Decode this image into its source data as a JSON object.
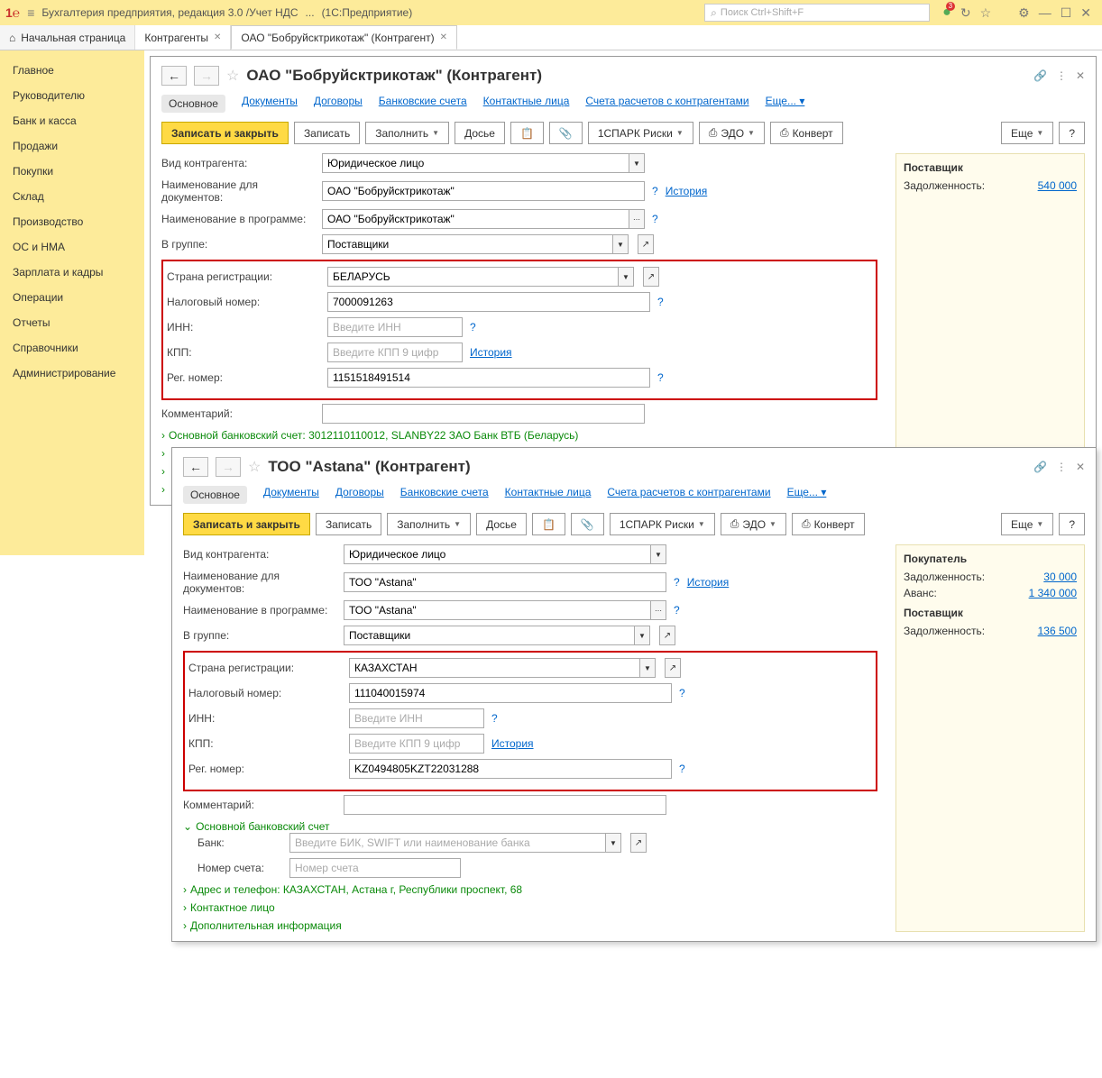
{
  "titlebar": {
    "app": "Бухгалтерия предприятия, редакция 3.0 /Учет НДС",
    "dots": "...",
    "mode": "(1С:Предприятие)",
    "search_ph": "Поиск Ctrl+Shift+F",
    "badge": "3"
  },
  "tabs": {
    "home": "Начальная страница",
    "t1": "Контрагенты",
    "t2": "ОАО \"Бобруйсктрикотаж\" (Контрагент)"
  },
  "sidebar": [
    "Главное",
    "Руководителю",
    "Банк и касса",
    "Продажи",
    "Покупки",
    "Склад",
    "Производство",
    "ОС и НМА",
    "Зарплата и кадры",
    "Операции",
    "Отчеты",
    "Справочники",
    "Администрирование"
  ],
  "tabbar": {
    "main": "Основное",
    "docs": "Документы",
    "contracts": "Договоры",
    "bank": "Банковские счета",
    "contacts": "Контактные лица",
    "accounts": "Счета расчетов с контрагентами",
    "more": "Еще..."
  },
  "toolbar": {
    "save_close": "Записать и закрыть",
    "save": "Записать",
    "fill": "Заполнить",
    "dossier": "Досье",
    "spark": "1СПАРК Риски",
    "edo": "ЭДО",
    "envelope": "Конверт",
    "more": "Еще",
    "help": "?"
  },
  "labels": {
    "type": "Вид контрагента:",
    "docname": "Наименование для документов:",
    "progname": "Наименование в программе:",
    "group": "В группе:",
    "country": "Страна регистрации:",
    "taxnum": "Налоговый номер:",
    "inn": "ИНН:",
    "kpp": "КПП:",
    "regnum": "Рег. номер:",
    "comment": "Комментарий:",
    "bank": "Банк:",
    "accnum": "Номер счета:",
    "history": "История",
    "inn_ph": "Введите ИНН",
    "kpp_ph": "Введите КПП 9 цифр",
    "bank_ph": "Введите БИК, SWIFT или наименование банка",
    "acc_ph": "Номер счета"
  },
  "card1": {
    "title": "ОАО \"Бобруйсктрикотаж\" (Контрагент)",
    "type": "Юридическое лицо",
    "docname": "ОАО \"Бобруйсктрикотаж\"",
    "progname": "ОАО \"Бобруйсктрикотаж\"",
    "group": "Поставщики",
    "country": "БЕЛАРУСЬ",
    "taxnum": "7000091263",
    "regnum": "1151518491514",
    "bankinfo": "Основной банковский счет: 3012110110012, SLANBY22 ЗАО Банк ВТБ (Беларусь)",
    "panel": {
      "role": "Поставщик",
      "debt_lbl": "Задолженность:",
      "debt": "540 000"
    }
  },
  "card2": {
    "title": "ТОО \"Astana\" (Контрагент)",
    "type": "Юридическое лицо",
    "docname": "ТОО \"Astana\"",
    "progname": "ТОО \"Astana\"",
    "group": "Поставщики",
    "country": "КАЗАХСТАН",
    "taxnum": "111040015974",
    "regnum": "KZ0494805KZT22031288",
    "bankacc": "Основной банковский счет",
    "addr": "Адрес и телефон: КАЗАХСТАН, Астана г, Республики проспект, 68",
    "contact": "Контактное лицо",
    "addinfo": "Дополнительная информация",
    "panel": {
      "role1": "Покупатель",
      "debt_lbl": "Задолженность:",
      "debt1": "30 000",
      "adv_lbl": "Аванс:",
      "adv": "1 340 000",
      "role2": "Поставщик",
      "debt2": "136 500"
    }
  }
}
